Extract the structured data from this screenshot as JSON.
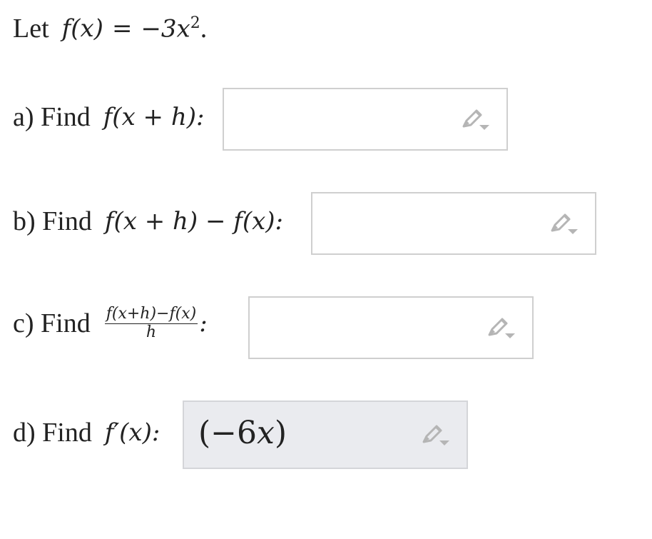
{
  "intro": {
    "label": "Let",
    "function_lhs": "f(x)",
    "equals": "=",
    "function_rhs_base": "−3x",
    "exponent": "2",
    "period": "."
  },
  "parts": [
    {
      "label": "a) Find",
      "expr": "f(x + h):",
      "value": "",
      "icon": "pencil-icon"
    },
    {
      "label": "b) Find",
      "expr": "f(x + h) − f(x):",
      "value": "",
      "icon": "pencil-icon"
    },
    {
      "label": "c) Find",
      "numerator": "f(x+h)−f(x)",
      "denominator": "h",
      "suffix": ":",
      "value": "",
      "icon": "pencil-icon"
    },
    {
      "label": "d) Find",
      "expr": "f′(x):",
      "value_open": "(−6",
      "value_var": "x",
      "value_close": ")",
      "icon": "pencil-icon"
    }
  ],
  "colors": {
    "box_border": "#cfcfcf",
    "filled_bg": "#eaebef",
    "icon_gray": "#b5b5b5"
  }
}
